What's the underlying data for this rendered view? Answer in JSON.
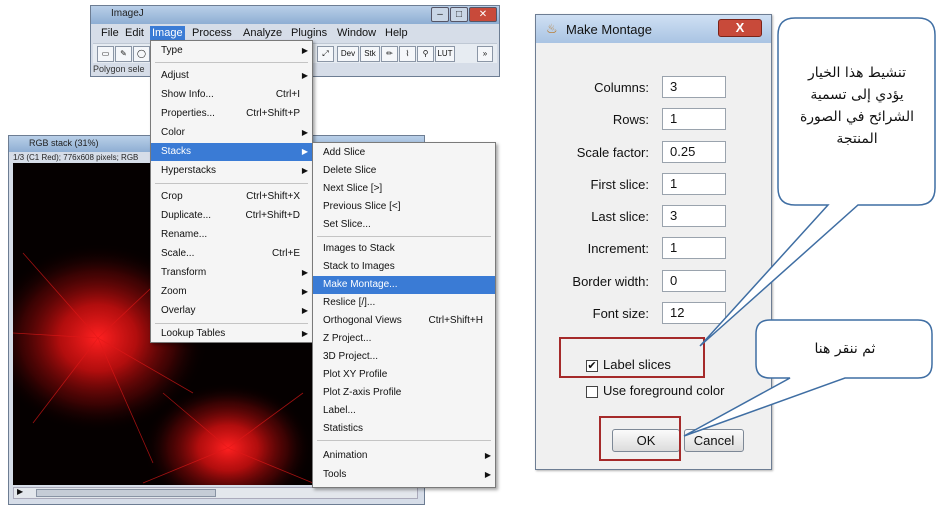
{
  "imagej": {
    "title": "ImageJ",
    "menubar": [
      "File",
      "Edit",
      "Image",
      "Process",
      "Analyze",
      "Plugins",
      "Window",
      "Help"
    ],
    "active_menu": "Image",
    "toolbar_text": [
      "Dev",
      "Stk",
      "LUT"
    ],
    "status": "Polygon sele"
  },
  "image_window": {
    "title": "RGB stack (31%)",
    "info": "1/3 (C1 Red); 776x608 pixels; RGB"
  },
  "image_menu": {
    "items": [
      {
        "label": "Type",
        "shortcut": "",
        "submenu": true
      },
      {
        "label": "Adjust",
        "shortcut": "",
        "submenu": true
      },
      {
        "label": "Show Info...",
        "shortcut": "Ctrl+I",
        "submenu": false
      },
      {
        "label": "Properties...",
        "shortcut": "Ctrl+Shift+P",
        "submenu": false
      },
      {
        "label": "Color",
        "shortcut": "",
        "submenu": true
      },
      {
        "label": "Stacks",
        "shortcut": "",
        "submenu": true,
        "highlighted": true
      },
      {
        "label": "Hyperstacks",
        "shortcut": "",
        "submenu": true
      },
      {
        "label": "Crop",
        "shortcut": "Ctrl+Shift+X",
        "submenu": false
      },
      {
        "label": "Duplicate...",
        "shortcut": "Ctrl+Shift+D",
        "submenu": false
      },
      {
        "label": "Rename...",
        "shortcut": "",
        "submenu": false
      },
      {
        "label": "Scale...",
        "shortcut": "Ctrl+E",
        "submenu": false
      },
      {
        "label": "Transform",
        "shortcut": "",
        "submenu": true
      },
      {
        "label": "Zoom",
        "shortcut": "",
        "submenu": true
      },
      {
        "label": "Overlay",
        "shortcut": "",
        "submenu": true
      },
      {
        "label": "Lookup Tables",
        "shortcut": "",
        "submenu": true
      }
    ]
  },
  "stacks_menu": {
    "items": [
      {
        "label": "Add Slice",
        "shortcut": ""
      },
      {
        "label": "Delete Slice",
        "shortcut": ""
      },
      {
        "label": "Next Slice [>]",
        "shortcut": ""
      },
      {
        "label": "Previous Slice [<]",
        "shortcut": ""
      },
      {
        "label": "Set Slice...",
        "shortcut": ""
      },
      {
        "label": "Images to Stack",
        "shortcut": ""
      },
      {
        "label": "Stack to Images",
        "shortcut": ""
      },
      {
        "label": "Make Montage...",
        "shortcut": "",
        "highlighted": true
      },
      {
        "label": "Reslice [/]...",
        "shortcut": ""
      },
      {
        "label": "Orthogonal Views",
        "shortcut": "Ctrl+Shift+H"
      },
      {
        "label": "Z Project...",
        "shortcut": ""
      },
      {
        "label": "3D Project...",
        "shortcut": ""
      },
      {
        "label": "Plot XY Profile",
        "shortcut": ""
      },
      {
        "label": "Plot Z-axis Profile",
        "shortcut": ""
      },
      {
        "label": "Label...",
        "shortcut": ""
      },
      {
        "label": "Statistics",
        "shortcut": ""
      },
      {
        "label": "Animation",
        "shortcut": "",
        "submenu": true
      },
      {
        "label": "Tools",
        "shortcut": "",
        "submenu": true
      }
    ]
  },
  "montage_dialog": {
    "title": "Make Montage",
    "close": "X",
    "fields": [
      {
        "label": "Columns:",
        "value": "3"
      },
      {
        "label": "Rows:",
        "value": "1"
      },
      {
        "label": "Scale factor:",
        "value": "0.25"
      },
      {
        "label": "First slice:",
        "value": "1"
      },
      {
        "label": "Last slice:",
        "value": "3"
      },
      {
        "label": "Increment:",
        "value": "1"
      },
      {
        "label": "Border width:",
        "value": "0"
      },
      {
        "label": "Font size:",
        "value": "12"
      }
    ],
    "label_slices": {
      "label": "Label slices",
      "checked": true
    },
    "use_foreground": {
      "label": "Use foreground color",
      "checked": false
    },
    "ok": "OK",
    "cancel": "Cancel"
  },
  "callouts": {
    "top": [
      "تنشيط هذا الخيار",
      "يؤدي إلى تسمية",
      "الشرائح في الصورة",
      "المنتجة"
    ],
    "bottom": "ثم ننقر هنا"
  },
  "colors": {
    "highlight": "#3a7bd5",
    "annotation_box": "#a52a2a",
    "image_signal": "#e01010"
  }
}
